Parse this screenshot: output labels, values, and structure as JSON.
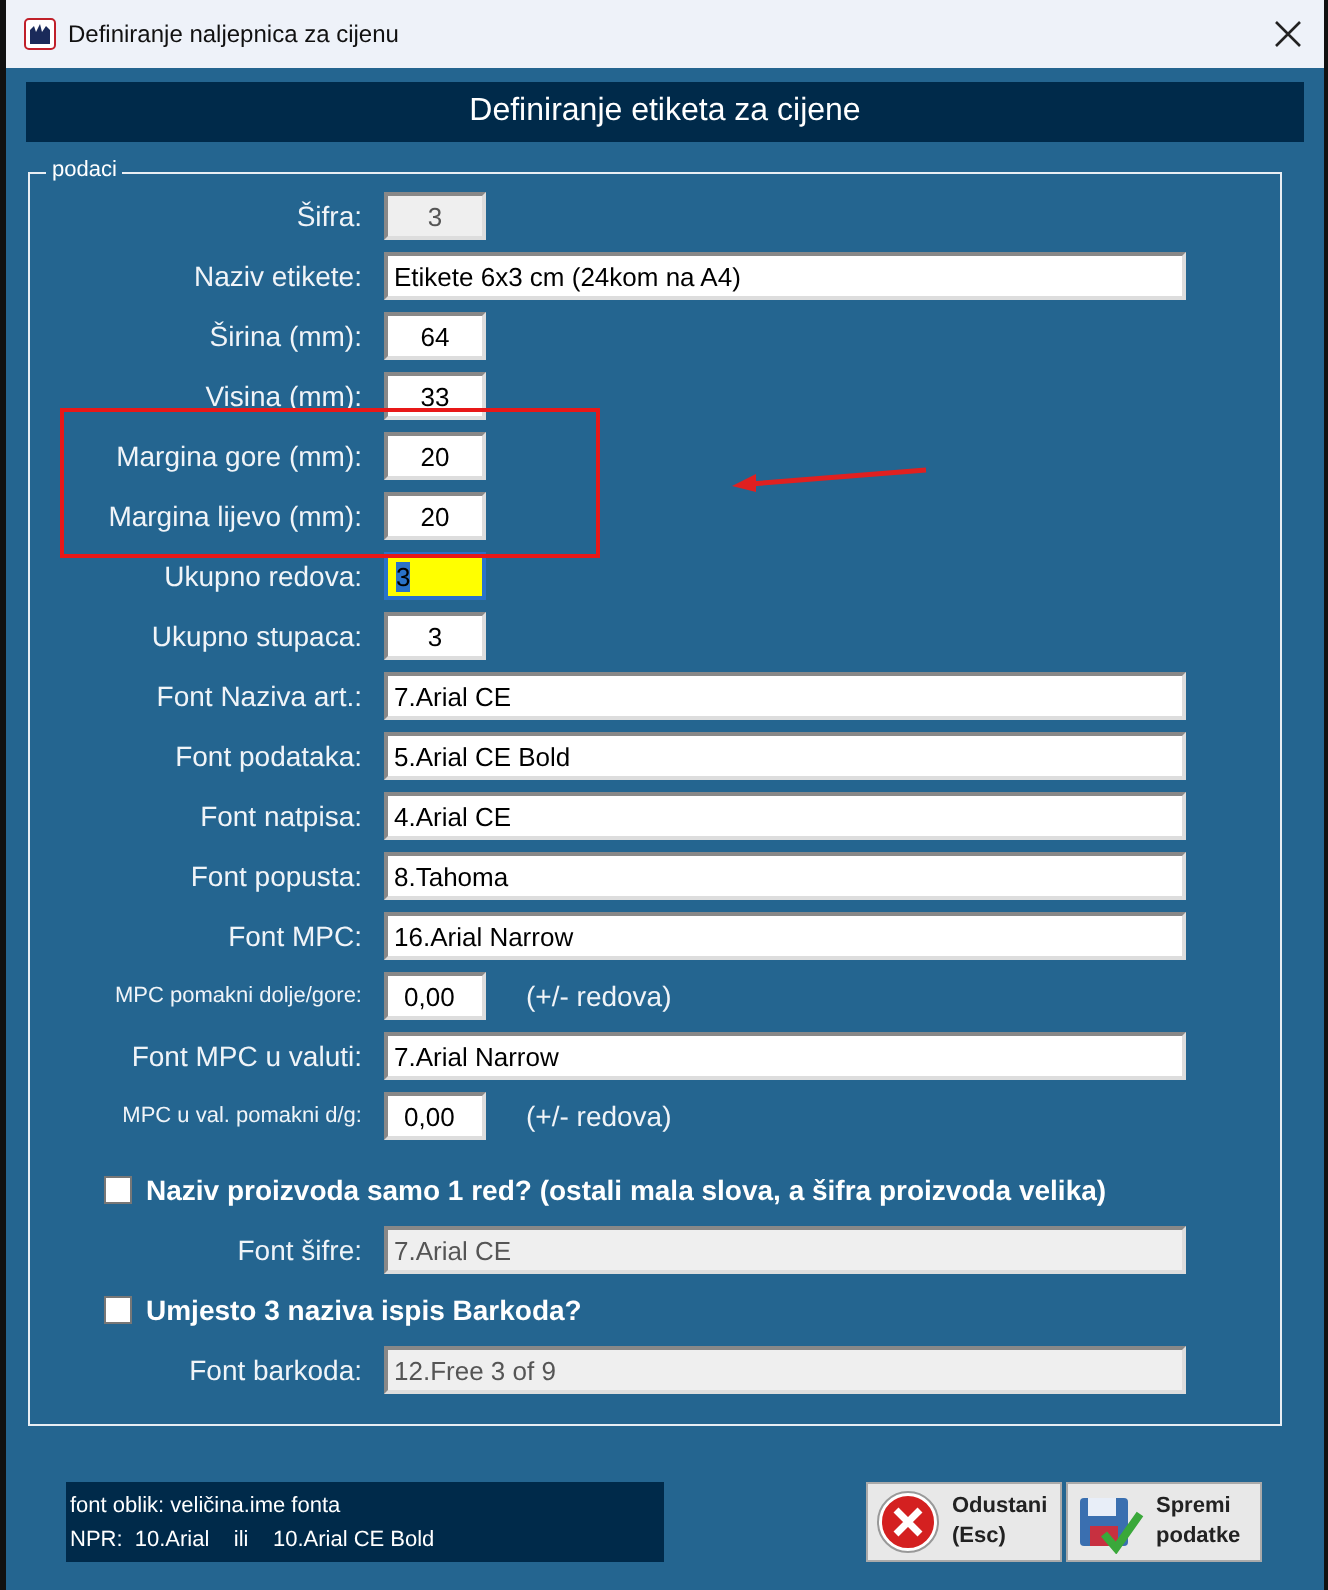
{
  "window": {
    "title": "Definiranje naljepnica za cijenu"
  },
  "header": "Definiranje etiketa za cijene",
  "group": {
    "legend": "podaci",
    "rows": [
      {
        "kind": "field",
        "label": "Šifra:",
        "value": "3",
        "wide": false,
        "disabled": true,
        "focused": false
      },
      {
        "kind": "field",
        "label": "Naziv etikete:",
        "value": "Etikete 6x3 cm (24kom na A4)",
        "wide": true,
        "disabled": false,
        "focused": false
      },
      {
        "kind": "field",
        "label": "Širina (mm):",
        "value": "64",
        "wide": false,
        "disabled": false,
        "focused": false
      },
      {
        "kind": "field",
        "label": "Visina (mm):",
        "value": "33",
        "wide": false,
        "disabled": false,
        "focused": false
      },
      {
        "kind": "field",
        "label": "Margina gore (mm):",
        "value": "20",
        "wide": false,
        "disabled": false,
        "focused": false
      },
      {
        "kind": "field",
        "label": "Margina lijevo (mm):",
        "value": "20",
        "wide": false,
        "disabled": false,
        "focused": false
      },
      {
        "kind": "field",
        "label": "Ukupno redova:",
        "value": "3",
        "wide": false,
        "disabled": false,
        "focused": true
      },
      {
        "kind": "field",
        "label": "Ukupno stupaca:",
        "value": "3",
        "wide": false,
        "disabled": false,
        "focused": false
      },
      {
        "kind": "field",
        "label": "Font Naziva art.:",
        "value": "7.Arial CE",
        "wide": true,
        "disabled": false,
        "focused": false
      },
      {
        "kind": "field",
        "label": "Font podataka:",
        "value": "5.Arial CE Bold",
        "wide": true,
        "disabled": false,
        "focused": false
      },
      {
        "kind": "field",
        "label": "Font natpisa:",
        "value": "4.Arial CE",
        "wide": true,
        "disabled": false,
        "focused": false
      },
      {
        "kind": "field",
        "label": "Font popusta:",
        "value": "8.Tahoma",
        "wide": true,
        "disabled": false,
        "focused": false
      },
      {
        "kind": "field",
        "label": "Font MPC:",
        "value": "16.Arial Narrow",
        "wide": true,
        "disabled": false,
        "focused": false
      },
      {
        "kind": "field",
        "label": "MPC pomakni dolje/gore:",
        "small_label": true,
        "value": "0,00",
        "wide": false,
        "left_aligned": true,
        "suffix": "(+/- redova)",
        "disabled": false,
        "focused": false
      },
      {
        "kind": "field",
        "label": "Font MPC u valuti:",
        "value": "7.Arial Narrow",
        "wide": true,
        "disabled": false,
        "focused": false
      },
      {
        "kind": "field",
        "label": "MPC u val. pomakni d/g:",
        "small_label": true,
        "value": "0,00",
        "wide": false,
        "left_aligned": true,
        "suffix": "(+/- redova)",
        "disabled": false,
        "focused": false
      },
      {
        "kind": "checkbox",
        "label": "Naziv proizvoda samo 1 red? (ostali mala slova, a šifra proizvoda velika)",
        "checked": false
      },
      {
        "kind": "field",
        "label": "Font šifre:",
        "value": "7.Arial CE",
        "wide": true,
        "disabled": true,
        "focused": false
      },
      {
        "kind": "checkbox",
        "label": "Umjesto 3 naziva ispis Barkoda?",
        "checked": false
      },
      {
        "kind": "field",
        "label": "Font barkoda:",
        "value": "12.Free 3 of 9",
        "wide": true,
        "disabled": true,
        "focused": false
      }
    ]
  },
  "note": [
    "font oblik: veličina.ime fonta",
    "NPR:  10.Arial    ili    10.Arial CE Bold"
  ],
  "buttons": [
    {
      "kind": "cancel",
      "label": "Odustani\n(Esc)"
    },
    {
      "kind": "save",
      "label": "Spremi\npodatke"
    }
  ],
  "markup": {
    "highlight_box": true,
    "arrow": true
  }
}
